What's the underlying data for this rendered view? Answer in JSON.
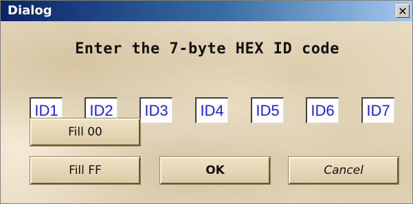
{
  "window": {
    "title": "Dialog",
    "close_glyph": "✕"
  },
  "heading": "Enter the 7-byte HEX ID code",
  "id_fields": [
    "ID1",
    "ID2",
    "ID3",
    "ID4",
    "ID5",
    "ID6",
    "ID7"
  ],
  "buttons": {
    "fill_00": "Fill 00",
    "fill_ff": "Fill FF",
    "ok": "OK",
    "cancel": "Cancel"
  },
  "colors": {
    "titlebar_start": "#0a246a",
    "titlebar_end": "#a6caf0",
    "id_text": "#1c1cff",
    "background": "#e8dcc3"
  }
}
